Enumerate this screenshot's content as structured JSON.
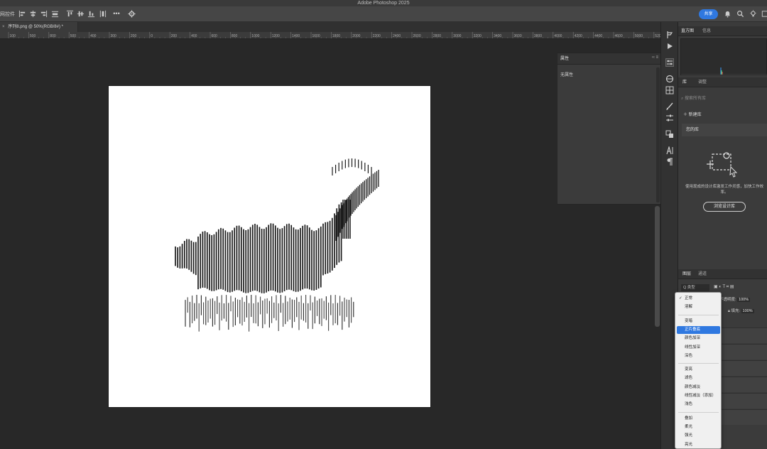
{
  "window": {
    "title": "Adobe Photoshop 2025"
  },
  "options_bar": {
    "tool_label": "网控件",
    "share_label": "共享",
    "more_label": "•••"
  },
  "document": {
    "tab_title": "序列8.png @ 50%(RGB/8#) *",
    "tab_close": "×"
  },
  "ruler": {
    "ticks": [
      "100",
      "500",
      "800",
      "500",
      "400",
      "300",
      "200",
      "0",
      "200",
      "400",
      "600",
      "800",
      "1000",
      "1200",
      "1400",
      "1600",
      "1800",
      "2000",
      "2200",
      "2400",
      "2600",
      "2800",
      "3000",
      "3200",
      "3400",
      "3600",
      "3800",
      "4000",
      "4200",
      "4400",
      "4600",
      "5000",
      "5200",
      "5400"
    ]
  },
  "properties_panel": {
    "tab_label": "属性",
    "empty_text": "无属性",
    "header_icons": "‹‹ ≡"
  },
  "dock": {
    "top_tabs": [
      "直方图",
      "信息"
    ],
    "mid_tabs": [
      "库",
      "调整"
    ],
    "library": {
      "search_placeholder": "搜索所有库",
      "new_library": "新建库",
      "my_library": "您的库",
      "description": "使用现成的设计库激发工作灵感，加快工作效率。",
      "browse_button": "浏览设计库"
    },
    "layer_tabs": [
      "图层",
      "通道"
    ],
    "layers_filter": "Q 类型",
    "opacity_label": "不透明度:",
    "opacity_value": "100%",
    "fill_label": "填充:",
    "fill_value": "100%"
  },
  "blend_menu": {
    "groups": [
      [
        {
          "label": "正常",
          "checked": true
        },
        {
          "label": "溶解"
        }
      ],
      [
        {
          "label": "变暗"
        },
        {
          "label": "正片叠底",
          "selected": true
        },
        {
          "label": "颜色加深"
        },
        {
          "label": "线性加深"
        },
        {
          "label": "深色"
        }
      ],
      [
        {
          "label": "变亮"
        },
        {
          "label": "滤色"
        },
        {
          "label": "颜色减淡"
        },
        {
          "label": "线性减淡（添加）"
        },
        {
          "label": "浅色"
        }
      ],
      [
        {
          "label": "叠加"
        },
        {
          "label": "柔光"
        },
        {
          "label": "强光"
        },
        {
          "label": "亮光"
        }
      ]
    ]
  },
  "colors": {
    "accent": "#2f78e0",
    "canvas_bg": "#282828",
    "artboard": "#ffffff",
    "panel": "#3b3b3b"
  }
}
